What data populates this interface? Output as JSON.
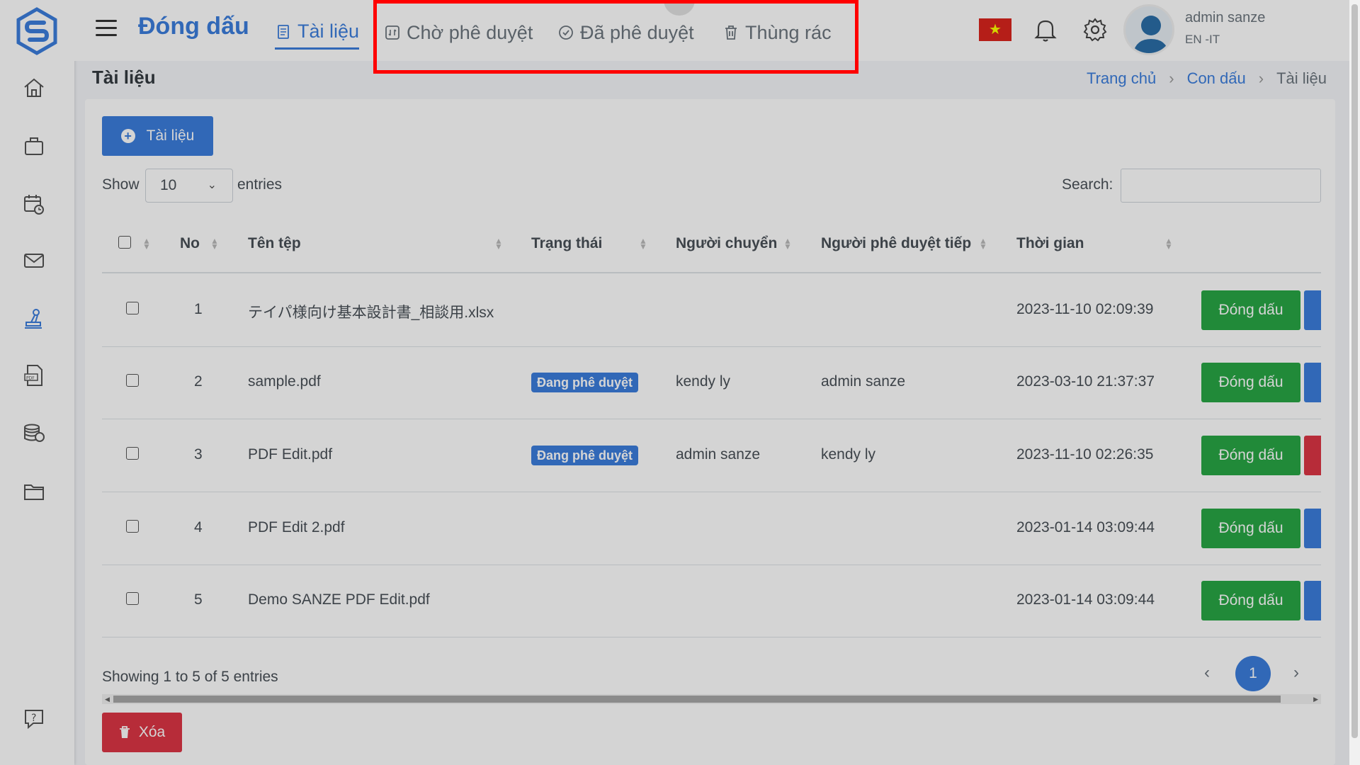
{
  "app": {
    "title": "Đóng dấu"
  },
  "nav_tabs": [
    {
      "label": "Tài liệu",
      "icon": "document-icon",
      "active": true
    },
    {
      "label": "Chờ phê duyệt",
      "icon": "pending-icon",
      "active": false
    },
    {
      "label": "Đã phê duyệt",
      "icon": "check-circle-icon",
      "active": false
    },
    {
      "label": "Thùng rác",
      "icon": "trash-icon",
      "active": false
    }
  ],
  "sidebar": {
    "items": [
      {
        "icon": "home-icon"
      },
      {
        "icon": "briefcase-icon"
      },
      {
        "icon": "calendar-clock-icon"
      },
      {
        "icon": "mail-icon"
      },
      {
        "icon": "stamp-icon",
        "active": true
      },
      {
        "icon": "pdf-file-icon"
      },
      {
        "icon": "coins-icon"
      },
      {
        "icon": "folder-icon"
      },
      {
        "icon": "help-icon"
      }
    ]
  },
  "user": {
    "name": "admin sanze",
    "subtitle": "EN -IT"
  },
  "page": {
    "title": "Tài liệu",
    "breadcrumb": [
      "Trang chủ",
      "Con dấu",
      "Tài liệu"
    ]
  },
  "toolbar": {
    "add_label": "Tài liệu",
    "show_label": "Show",
    "show_value": "10",
    "entries_label": "entries",
    "search_label": "Search:",
    "search_value": ""
  },
  "table": {
    "headers": {
      "no": "No",
      "file_name": "Tên tệp",
      "status": "Trạng thái",
      "sender": "Người chuyển",
      "next_approver": "Người phê duyệt tiếp",
      "time": "Thời gian"
    },
    "action_label": "Đóng dấu",
    "rows": [
      {
        "no": "1",
        "file_name": "テイパ様向け基本設計書_相談用.xlsx",
        "status": "",
        "sender": "",
        "next_approver": "",
        "time": "2023-11-10 02:09:39",
        "side_color": "#3b7ddd"
      },
      {
        "no": "2",
        "file_name": "sample.pdf",
        "status": "Đang phê duyệt",
        "sender": "kendy ly",
        "next_approver": "admin sanze",
        "time": "2023-03-10 21:37:37",
        "side_color": "#3b7ddd"
      },
      {
        "no": "3",
        "file_name": "PDF Edit.pdf",
        "status": "Đang phê duyệt",
        "sender": "admin sanze",
        "next_approver": "kendy ly",
        "time": "2023-11-10 02:26:35",
        "side_color": "#dc3545"
      },
      {
        "no": "4",
        "file_name": "PDF Edit 2.pdf",
        "status": "",
        "sender": "",
        "next_approver": "",
        "time": "2023-01-14 03:09:44",
        "side_color": "#3b7ddd"
      },
      {
        "no": "5",
        "file_name": "Demo SANZE PDF Edit.pdf",
        "status": "",
        "sender": "",
        "next_approver": "",
        "time": "2023-01-14 03:09:44",
        "side_color": "#3b7ddd"
      }
    ]
  },
  "footer": {
    "info": "Showing 1 to 5 of 5 entries",
    "page": "1",
    "delete_label": "Xóa"
  },
  "colors": {
    "primary": "#3b7ddd",
    "success": "#28a745",
    "danger": "#dc3545",
    "highlight": "#ff0000"
  }
}
